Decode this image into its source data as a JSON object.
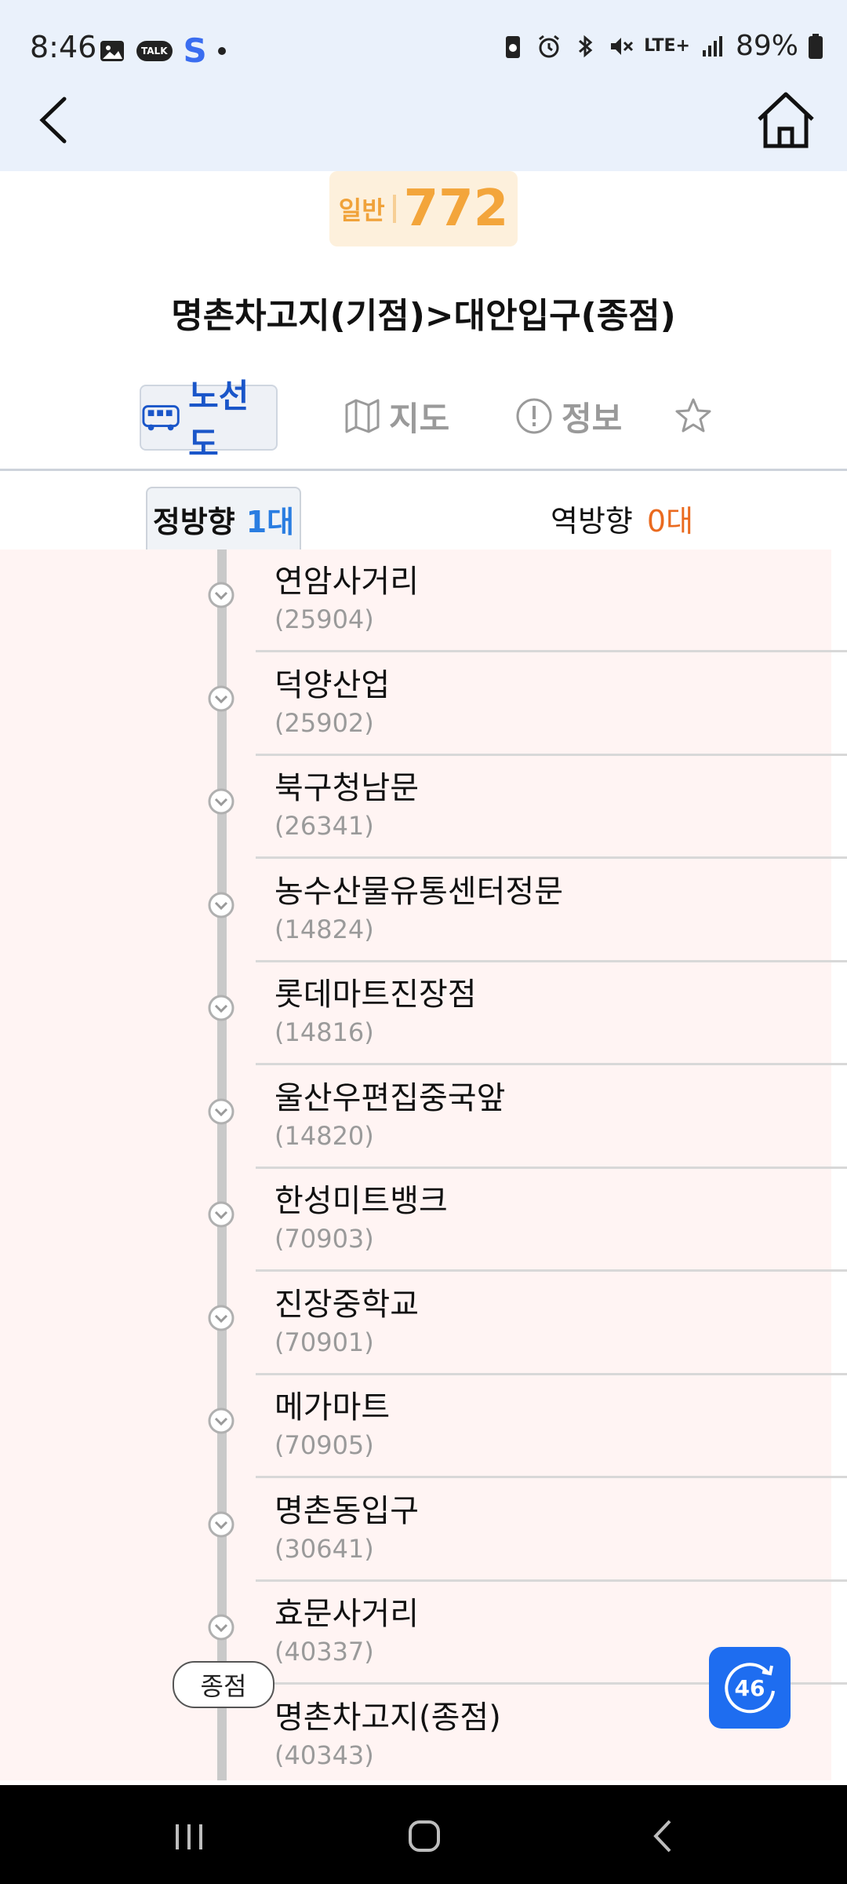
{
  "status_bar": {
    "time": "8:46",
    "talk_label": "TALK",
    "s_label": "S",
    "network": "LTE+",
    "battery": "89%"
  },
  "route": {
    "type_label": "일반",
    "number": "772",
    "title": "명촌차고지(기점)>대안입구(종점)"
  },
  "tabs": [
    {
      "label": "노선도",
      "icon": "bus-icon",
      "active": true
    },
    {
      "label": "지도",
      "icon": "map-icon"
    },
    {
      "label": "정보",
      "icon": "info-icon"
    },
    {
      "label": "",
      "icon": "star-icon"
    }
  ],
  "directions": {
    "forward": {
      "label": "정방향",
      "count": "1대"
    },
    "reverse": {
      "label": "역방향",
      "count": "0대"
    }
  },
  "stops": [
    {
      "name": "연암사거리",
      "code": "(25904)"
    },
    {
      "name": "덕양산업",
      "code": "(25902)"
    },
    {
      "name": "북구청남문",
      "code": "(26341)"
    },
    {
      "name": "농수산물유통센터정문",
      "code": "(14824)"
    },
    {
      "name": "롯데마트진장점",
      "code": "(14816)"
    },
    {
      "name": "울산우편집중국앞",
      "code": "(14820)"
    },
    {
      "name": "한성미트뱅크",
      "code": "(70903)"
    },
    {
      "name": "진장중학교",
      "code": "(70901)"
    },
    {
      "name": "메가마트",
      "code": "(70905)"
    },
    {
      "name": "명촌동입구",
      "code": "(30641)"
    },
    {
      "name": "효문사거리",
      "code": "(40337)"
    },
    {
      "name": "명촌차고지(종점)",
      "code": "(40343)"
    }
  ],
  "terminal_label": "종점",
  "refresh": {
    "seconds": "46"
  },
  "colors": {
    "header_bg": "#eaf1fb",
    "accent_blue": "#1a56c9",
    "route_orange": "#f3a53b",
    "list_bg": "#fff4f3",
    "reverse_count": "#ea6a1f"
  }
}
